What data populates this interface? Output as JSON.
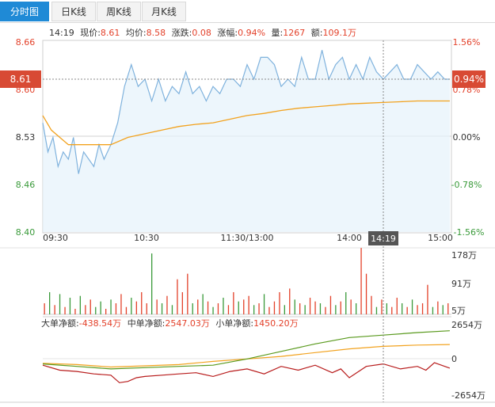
{
  "tabs": [
    {
      "label": "分时图",
      "active": true
    },
    {
      "label": "日K线",
      "active": false
    },
    {
      "label": "周K线",
      "active": false
    },
    {
      "label": "月K线",
      "active": false
    }
  ],
  "info": {
    "time": "14:19",
    "price_label": "现价:",
    "price": "8.61",
    "avg_label": "均价:",
    "avg": "8.58",
    "chg_label": "涨跌:",
    "chg": "0.08",
    "pct_label": "涨幅:",
    "pct": "0.94%",
    "vol_label": "量:",
    "vol": "1267",
    "amt_label": "额:",
    "amt": "109.1万"
  },
  "cursor": {
    "price": "8.61",
    "pct": "0.94%",
    "time": "14:19"
  },
  "colors": {
    "up": "#e3412a",
    "down": "#3a9a3a",
    "price_line": "#7fb2dd",
    "avg_line": "#f2a21e",
    "tab_active": "#1f8ad6",
    "small_line": "#f2a21e",
    "mid_line": "#5a9a1e",
    "big_line": "#b81c1c"
  },
  "chart_data": [
    {
      "type": "line",
      "name": "price",
      "x_ticks": [
        "09:30",
        "10:30",
        "11:30/13:00",
        "14:00",
        "15:00"
      ],
      "y_left_ticks": [
        "8.66",
        "8.60",
        "8.53",
        "8.46",
        "8.40"
      ],
      "y_right_ticks": [
        "1.56%",
        "0.78%",
        "0.00%",
        "-0.78%",
        "-1.56%"
      ],
      "ylim": [
        8.4,
        8.66
      ],
      "prev_close": 8.53,
      "xlim": [
        0,
        240
      ],
      "series": [
        {
          "name": "现价",
          "x": [
            0,
            3,
            6,
            9,
            12,
            15,
            18,
            21,
            24,
            27,
            30,
            33,
            36,
            40,
            44,
            48,
            52,
            56,
            60,
            64,
            68,
            72,
            76,
            80,
            84,
            88,
            92,
            96,
            100,
            104,
            108,
            112,
            116,
            120,
            124,
            128,
            132,
            136,
            140,
            144,
            148,
            152,
            156,
            160,
            164,
            168,
            172,
            176,
            180,
            184,
            188,
            192,
            196,
            200,
            204,
            208,
            212,
            216,
            220,
            224,
            228,
            232,
            236,
            239
          ],
          "values": [
            8.55,
            8.51,
            8.53,
            8.49,
            8.51,
            8.5,
            8.53,
            8.48,
            8.51,
            8.5,
            8.49,
            8.52,
            8.5,
            8.52,
            8.55,
            8.6,
            8.63,
            8.6,
            8.61,
            8.58,
            8.61,
            8.58,
            8.6,
            8.59,
            8.62,
            8.59,
            8.6,
            8.58,
            8.6,
            8.59,
            8.61,
            8.61,
            8.6,
            8.63,
            8.61,
            8.64,
            8.64,
            8.63,
            8.6,
            8.61,
            8.6,
            8.64,
            8.61,
            8.61,
            8.65,
            8.61,
            8.63,
            8.64,
            8.61,
            8.63,
            8.61,
            8.64,
            8.62,
            8.61,
            8.62,
            8.63,
            8.61,
            8.61,
            8.63,
            8.62,
            8.61,
            8.62,
            8.61,
            8.61
          ]
        },
        {
          "name": "均价",
          "x": [
            0,
            5,
            10,
            15,
            20,
            30,
            40,
            50,
            60,
            70,
            80,
            90,
            100,
            110,
            120,
            130,
            140,
            150,
            160,
            170,
            180,
            190,
            200,
            210,
            220,
            230,
            239
          ],
          "values": [
            8.56,
            8.54,
            8.53,
            8.52,
            8.52,
            8.52,
            8.52,
            8.53,
            8.535,
            8.54,
            8.545,
            8.548,
            8.55,
            8.555,
            8.56,
            8.563,
            8.567,
            8.57,
            8.572,
            8.574,
            8.576,
            8.577,
            8.578,
            8.579,
            8.58,
            8.58,
            8.58
          ]
        }
      ]
    },
    {
      "type": "bar",
      "name": "volume",
      "y_ticks": [
        "178万",
        "91万",
        "5万"
      ],
      "ylim": [
        0,
        178
      ],
      "x": [
        1,
        4,
        7,
        10,
        13,
        16,
        19,
        22,
        25,
        28,
        31,
        34,
        37,
        40,
        43,
        46,
        49,
        52,
        55,
        58,
        61,
        64,
        67,
        70,
        73,
        76,
        79,
        82,
        85,
        88,
        91,
        94,
        97,
        100,
        103,
        106,
        109,
        112,
        115,
        118,
        121,
        124,
        127,
        130,
        133,
        136,
        139,
        142,
        145,
        148,
        151,
        154,
        157,
        160,
        163,
        166,
        169,
        172,
        175,
        178,
        181,
        184,
        187,
        190,
        193,
        196,
        199,
        202,
        205,
        208,
        211,
        214,
        217,
        220,
        223,
        226,
        229,
        232,
        235,
        238
      ],
      "values": [
        30,
        60,
        25,
        55,
        20,
        45,
        15,
        50,
        25,
        40,
        20,
        35,
        15,
        40,
        30,
        55,
        20,
        45,
        35,
        60,
        30,
        165,
        40,
        30,
        50,
        25,
        95,
        60,
        110,
        30,
        40,
        55,
        35,
        20,
        30,
        45,
        25,
        60,
        35,
        40,
        50,
        25,
        30,
        55,
        20,
        35,
        60,
        25,
        70,
        40,
        30,
        25,
        45,
        35,
        30,
        20,
        50,
        25,
        35,
        60,
        40,
        30,
        180,
        110,
        50,
        20,
        40,
        30,
        20,
        45,
        30,
        20,
        40,
        25,
        30,
        80,
        20,
        35,
        25,
        30
      ],
      "up": [
        1,
        0,
        1,
        0,
        1,
        0,
        1,
        0,
        1,
        1,
        0,
        0,
        1,
        0,
        1,
        1,
        1,
        0,
        1,
        1,
        1,
        0,
        1,
        0,
        1,
        0,
        1,
        1,
        1,
        0,
        1,
        0,
        1,
        0,
        1,
        0,
        1,
        1,
        0,
        1,
        1,
        0,
        1,
        0,
        1,
        1,
        1,
        0,
        1,
        0,
        1,
        0,
        1,
        1,
        0,
        1,
        1,
        0,
        1,
        0,
        1,
        0,
        1,
        1,
        1,
        0,
        1,
        0,
        1,
        1,
        0,
        1,
        0,
        1,
        1,
        1,
        0,
        1,
        0,
        1
      ]
    },
    {
      "type": "line",
      "name": "fund_flow",
      "y_ticks": [
        "2654万",
        "0",
        "-2654万"
      ],
      "ylim": [
        -2654,
        2654
      ],
      "labels": {
        "big": "大单净额:",
        "big_val": "-438.54万",
        "mid": "中单净额:",
        "mid_val": "2547.03万",
        "small": "小单净额:",
        "small_val": "1450.20万"
      },
      "series": [
        {
          "name": "小单净额",
          "x": [
            0,
            20,
            40,
            60,
            80,
            100,
            120,
            140,
            160,
            180,
            200,
            220,
            239
          ],
          "values": [
            -50,
            -150,
            -350,
            -250,
            -150,
            100,
            300,
            500,
            800,
            1100,
            1300,
            1400,
            1450
          ]
        },
        {
          "name": "中单净额",
          "x": [
            0,
            20,
            40,
            60,
            80,
            100,
            120,
            140,
            160,
            180,
            200,
            220,
            239
          ],
          "values": [
            -100,
            -300,
            -500,
            -400,
            -300,
            -200,
            300,
            900,
            1500,
            2000,
            2200,
            2400,
            2547
          ]
        },
        {
          "name": "大单净额",
          "x": [
            0,
            10,
            20,
            30,
            40,
            45,
            50,
            55,
            60,
            70,
            80,
            90,
            100,
            110,
            120,
            130,
            140,
            150,
            160,
            170,
            175,
            180,
            190,
            200,
            210,
            220,
            225,
            230,
            239
          ],
          "values": [
            -200,
            -600,
            -700,
            -900,
            -1000,
            -1600,
            -1500,
            -1200,
            -1100,
            -1000,
            -900,
            -800,
            -1100,
            -700,
            -500,
            -900,
            -300,
            -600,
            -200,
            -800,
            -500,
            -1200,
            -300,
            -100,
            -500,
            -300,
            -600,
            0,
            -438
          ]
        }
      ]
    }
  ]
}
